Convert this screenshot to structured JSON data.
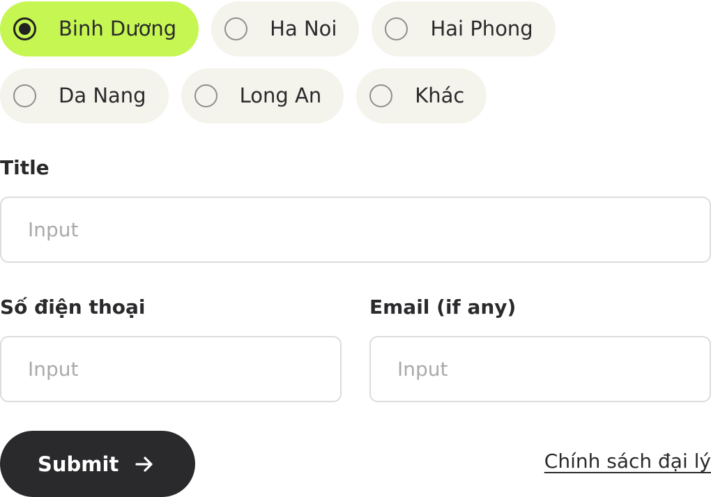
{
  "regions": {
    "options": [
      {
        "label": "Binh Dương",
        "selected": true
      },
      {
        "label": "Ha Noi",
        "selected": false
      },
      {
        "label": "Hai Phong",
        "selected": false
      },
      {
        "label": "Da Nang",
        "selected": false
      },
      {
        "label": "Long An",
        "selected": false
      },
      {
        "label": "Khác",
        "selected": false
      }
    ]
  },
  "form": {
    "title_label": "Title",
    "title_placeholder": "Input",
    "phone_label": "Số điện thoại",
    "phone_placeholder": "Input",
    "email_label": "Email (if any)",
    "email_placeholder": "Input"
  },
  "actions": {
    "submit_label": "Submit",
    "submit_icon": "arrow-right-icon",
    "policy_link": "Chính sách đại lý"
  },
  "colors": {
    "selected_chip": "#c6f652",
    "chip": "#f4f3ec",
    "dark": "#2a2a2c",
    "input_border": "#dcdcdc",
    "placeholder": "#a9a9a9"
  }
}
